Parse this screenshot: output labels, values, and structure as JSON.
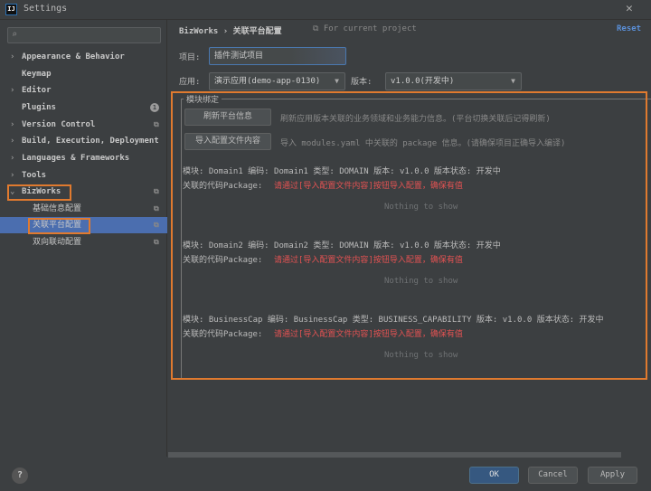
{
  "window": {
    "title": "Settings",
    "close": "✕",
    "logo": "IJ"
  },
  "search": {
    "icon": "⌕",
    "placeholder": ""
  },
  "sidebar": {
    "items": [
      {
        "label": "Appearance & Behavior",
        "arrow": "›"
      },
      {
        "label": "Keymap",
        "arrow": ""
      },
      {
        "label": "Editor",
        "arrow": "›"
      },
      {
        "label": "Plugins",
        "arrow": "",
        "badge": "1"
      },
      {
        "label": "Version Control",
        "arrow": "›"
      },
      {
        "label": "Build, Execution, Deployment",
        "arrow": "›"
      },
      {
        "label": "Languages & Frameworks",
        "arrow": "›"
      },
      {
        "label": "Tools",
        "arrow": "›"
      },
      {
        "label": "BizWorks",
        "arrow": "⌄"
      },
      {
        "label": "基础信息配置"
      },
      {
        "label": "关联平台配置"
      },
      {
        "label": "双向联动配置"
      }
    ]
  },
  "header": {
    "breadcrumb": "BizWorks  ›  关联平台配置",
    "scope_icon": "⧉",
    "scope": "For current project",
    "reset": "Reset"
  },
  "form": {
    "project_label": "项目:",
    "project_value": "插件测试项目",
    "app_label": "应用:",
    "app_value": "演示应用(demo-app-0130)",
    "version_label": "版本:",
    "version_value": "v1.0.0(开发中)",
    "dd": "▼"
  },
  "binding": {
    "legend": "模块绑定",
    "refresh_btn": "刷新平台信息",
    "refresh_hint": "刷新应用版本关联的业务领域和业务能力信息。(平台切换关联后记得刷新)",
    "import_btn": "导入配置文件内容",
    "import_hint": "导入 modules.yaml 中关联的 package 信息。(请确保项目正确导入编译)",
    "modules": [
      {
        "line": "模块: Domain1    编码: Domain1    类型: DOMAIN    版本: v1.0.0    版本状态: 开发中",
        "pkg_label": "关联的代码Package:",
        "pkg_value": "请通过[导入配置文件内容]按钮导入配置，确保有值",
        "empty": "Nothing to show"
      },
      {
        "line": "模块: Domain2    编码: Domain2    类型: DOMAIN    版本: v1.0.0    版本状态: 开发中",
        "pkg_label": "关联的代码Package:",
        "pkg_value": "请通过[导入配置文件内容]按钮导入配置，确保有值",
        "empty": "Nothing to show"
      },
      {
        "line": "模块: BusinessCap    编码: BusinessCap    类型: BUSINESS_CAPABILITY    版本: v1.0.0    版本状态: 开发中",
        "pkg_label": "关联的代码Package:",
        "pkg_value": "请通过[导入配置文件内容]按钮导入配置，确保有值",
        "empty": "Nothing to show"
      }
    ]
  },
  "footer": {
    "help": "?",
    "ok": "OK",
    "cancel": "Cancel",
    "apply": "Apply"
  },
  "colors": {
    "accent": "#4b6eaf",
    "highlight": "#e07a2f",
    "error": "#e25252"
  }
}
